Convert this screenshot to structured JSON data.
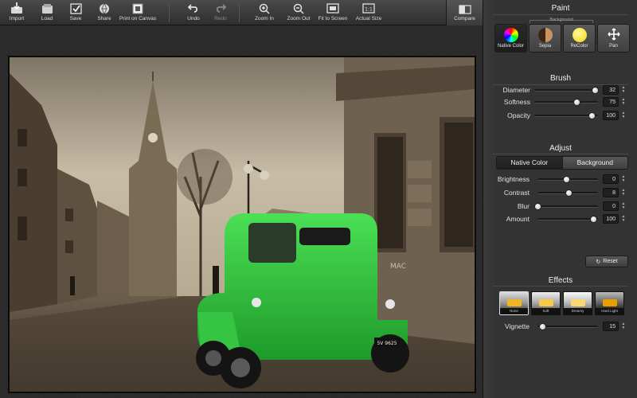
{
  "toolbar": {
    "items": [
      {
        "label": "Import",
        "icon": "import-icon"
      },
      {
        "label": "Load",
        "icon": "load-icon"
      },
      {
        "label": "Save",
        "icon": "save-icon"
      },
      {
        "label": "Share",
        "icon": "share-icon"
      },
      {
        "label": "Print on Canvas",
        "icon": "print-canvas-icon"
      },
      {
        "label": "Undo",
        "icon": "undo-icon"
      },
      {
        "label": "Redo",
        "icon": "redo-icon"
      },
      {
        "label": "Zoom In",
        "icon": "zoom-in-icon"
      },
      {
        "label": "Zoom Out",
        "icon": "zoom-out-icon"
      },
      {
        "label": "Fit to Screen",
        "icon": "fit-screen-icon"
      },
      {
        "label": "Actual Size",
        "icon": "actual-size-icon"
      }
    ],
    "compare_label": "Compare"
  },
  "panel": {
    "paint": {
      "title": "Paint",
      "background_caption": "Background",
      "buttons": [
        {
          "label": "Native Color",
          "icon": "color-wheel-icon"
        },
        {
          "label": "Sepia",
          "icon": "sepia-icon"
        },
        {
          "label": "ReColor",
          "icon": "recolor-icon"
        },
        {
          "label": "Pan",
          "icon": "pan-icon"
        }
      ],
      "selected": "Native Color"
    },
    "brush": {
      "title": "Brush",
      "diameter": {
        "label": "Diameter",
        "value": "32"
      },
      "softness": {
        "label": "Softness",
        "value": "75"
      },
      "opacity": {
        "label": "Opacity",
        "value": "100"
      }
    },
    "adjust": {
      "title": "Adjust",
      "tabs": [
        "Native Color",
        "Background"
      ],
      "active_tab": "Native Color",
      "brightness": {
        "label": "Brightness",
        "value": "0"
      },
      "contrast": {
        "label": "Contrast",
        "value": "8"
      },
      "blur": {
        "label": "Blur",
        "value": "0"
      },
      "amount": {
        "label": "Amount",
        "value": "100"
      },
      "reset_label": "Reset"
    },
    "effects": {
      "title": "Effects",
      "presets": [
        "None",
        "Soft",
        "Dreamy",
        "Hard Light"
      ],
      "selected": "None",
      "vignette": {
        "label": "Vignette",
        "value": "15"
      }
    }
  },
  "photo": {
    "car_plate": "5V 9625"
  },
  "colors": {
    "car": "#2ec93a",
    "sepia_sky": "#b8ab93",
    "panel_bg": "#333333"
  }
}
